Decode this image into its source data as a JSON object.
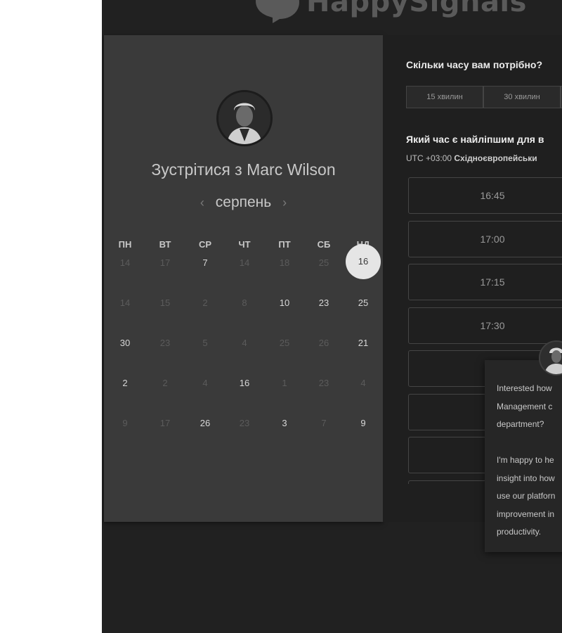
{
  "brand": {
    "name": "HappySignals"
  },
  "booking": {
    "title_prefix": "Зустрітися з",
    "host_name": "Marc Wilson",
    "month": "серпень",
    "prev_arrow": "‹",
    "next_arrow": "›"
  },
  "calendar": {
    "weekdays": [
      "ПН",
      "ВТ",
      "СР",
      "ЧТ",
      "ПТ",
      "СБ",
      "НД"
    ],
    "weeks": [
      [
        {
          "d": "14",
          "s": "muted"
        },
        {
          "d": "17",
          "s": "muted"
        },
        {
          "d": "7",
          "s": "avail"
        },
        {
          "d": "14",
          "s": "muted"
        },
        {
          "d": "18",
          "s": "muted"
        },
        {
          "d": "25",
          "s": "muted"
        },
        {
          "d": "16",
          "s": "selected"
        }
      ],
      [
        {
          "d": "14",
          "s": "muted"
        },
        {
          "d": "15",
          "s": "muted"
        },
        {
          "d": "2",
          "s": "muted"
        },
        {
          "d": "8",
          "s": "muted"
        },
        {
          "d": "10",
          "s": "avail"
        },
        {
          "d": "23",
          "s": "avail"
        },
        {
          "d": "25",
          "s": "avail"
        }
      ],
      [
        {
          "d": "30",
          "s": "avail"
        },
        {
          "d": "23",
          "s": "muted"
        },
        {
          "d": "5",
          "s": "muted"
        },
        {
          "d": "4",
          "s": "muted"
        },
        {
          "d": "25",
          "s": "muted"
        },
        {
          "d": "26",
          "s": "muted"
        },
        {
          "d": "21",
          "s": "avail"
        }
      ],
      [
        {
          "d": "2",
          "s": "avail"
        },
        {
          "d": "2",
          "s": "muted"
        },
        {
          "d": "4",
          "s": "muted"
        },
        {
          "d": "16",
          "s": "avail"
        },
        {
          "d": "1",
          "s": "muted"
        },
        {
          "d": "23",
          "s": "muted"
        },
        {
          "d": "4",
          "s": "muted"
        }
      ],
      [
        {
          "d": "9",
          "s": "muted"
        },
        {
          "d": "17",
          "s": "muted"
        },
        {
          "d": "26",
          "s": "avail"
        },
        {
          "d": "23",
          "s": "muted"
        },
        {
          "d": "3",
          "s": "avail"
        },
        {
          "d": "7",
          "s": "muted"
        },
        {
          "d": "9",
          "s": "avail"
        }
      ]
    ]
  },
  "duration": {
    "question": "Скільки часу вам потрібно?",
    "options": [
      "15 хвилин",
      "30 хвилин",
      ""
    ]
  },
  "time": {
    "question": "Який час є найліпшим для в",
    "tz_offset": "UTC +03:00",
    "tz_name": "Східноєвропейськи",
    "slots": [
      "16:45",
      "17:00",
      "17:15",
      "17:30",
      "",
      "",
      "",
      ""
    ]
  },
  "chat": {
    "message": "Interested how\nManagement c\ndepartment?\n\nI'm happy to he\ninsight into how\nuse our platforn\nimprovement in\nproductivity."
  },
  "colors": {
    "page_bg": "#212121",
    "panel_bg": "#3a3a3a",
    "selected_day": "#e5e5e5"
  }
}
